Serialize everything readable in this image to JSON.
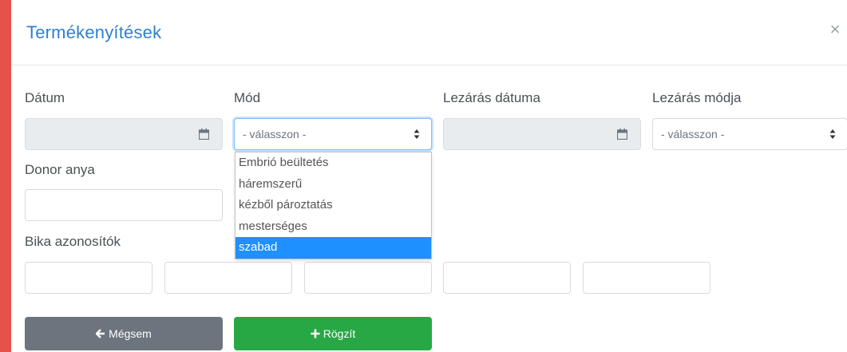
{
  "modal": {
    "title": "Termékenyítések",
    "close_glyph": "×"
  },
  "form": {
    "date_label": "Dátum",
    "mode_label": "Mód",
    "mode_select_value": "- válasszon -",
    "mode_options": [
      "Embrió beültetés",
      "háremszerű",
      "kézből pároztatás",
      "mesterséges",
      "szabad"
    ],
    "mode_highlighted_option": "szabad",
    "closing_date_label": "Lezárás dátuma",
    "closing_mode_label": "Lezárás módja",
    "closing_mode_select_value": "- válasszon -",
    "donor_mother_label": "Donor anya",
    "bull_ids_label": "Bika azonosítók"
  },
  "buttons": {
    "cancel_label": "Mégsem",
    "save_label": "Rögzít"
  },
  "colors": {
    "title_blue": "#2f7fd1",
    "cancel_gray": "#6c757d",
    "save_green": "#28a745",
    "highlight_blue": "#1e90ff",
    "background_red": "#e5514b"
  },
  "icons": {
    "calendar": "calendar-icon",
    "select_arrows": "sort-icon",
    "cancel": "arrow-left-icon",
    "save": "plus-icon",
    "close": "close-icon"
  }
}
